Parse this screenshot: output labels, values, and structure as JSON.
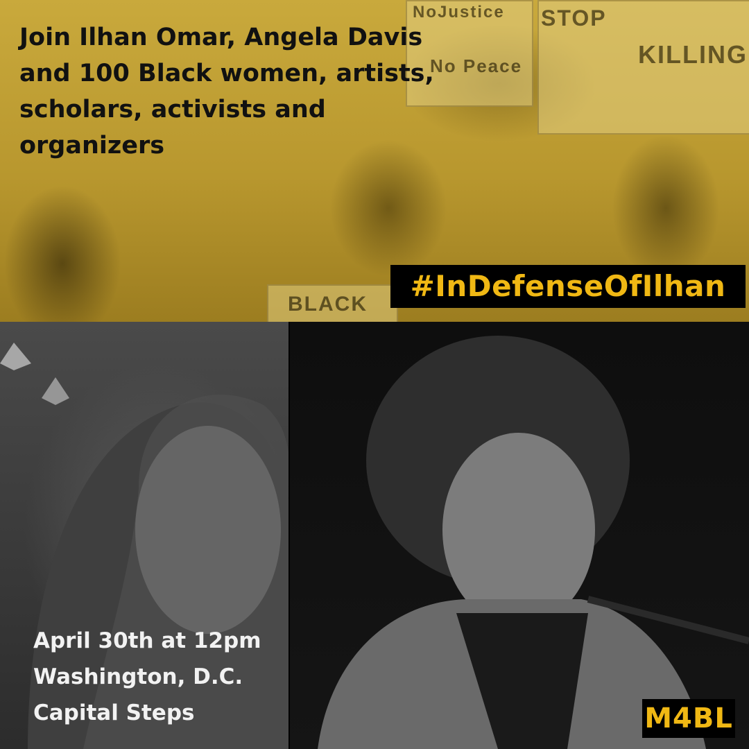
{
  "headline": "Join Ilhan Omar, Angela Davis and 100 Black women, artists, scholars, activists and organizers",
  "hashtag": "#InDefenseOfIlhan",
  "event": {
    "line1": "April 30th at 12pm",
    "line2": "Washington, D.C.",
    "line3": "Capital Steps"
  },
  "logo": "M4BL",
  "signs": {
    "no_justice": "NoJustice",
    "no_peace": "No Peace",
    "stop": "STOP",
    "killing": "KILLING",
    "black": "BLACK"
  },
  "colors": {
    "accent_gold": "#f0b814",
    "band_gold": "#b8972e",
    "text_dark": "#111111",
    "text_light": "#f2f2f2"
  }
}
